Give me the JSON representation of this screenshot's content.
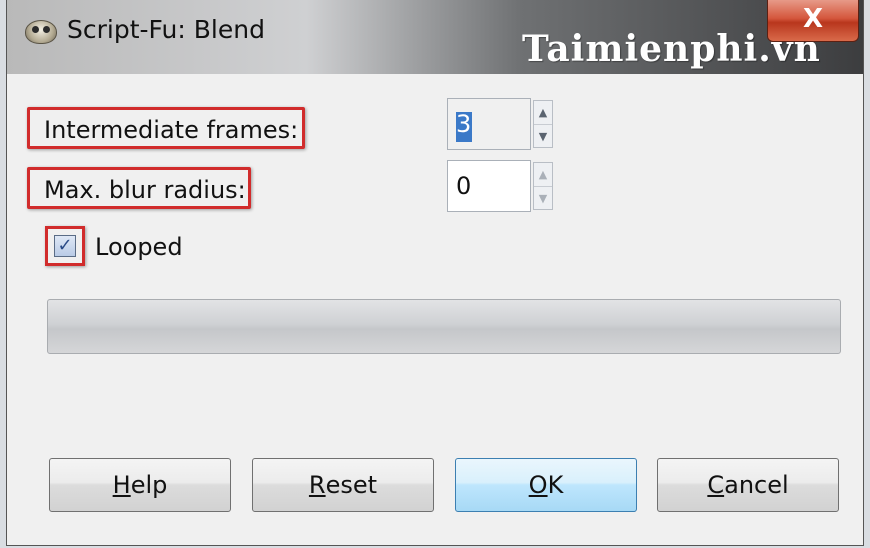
{
  "window": {
    "title": "Script-Fu: Blend",
    "watermark": "Taimienphi.vn",
    "close_glyph": "X",
    "icon": "gimp-wilber-icon"
  },
  "fields": {
    "intermediate_frames": {
      "label": "Intermediate frames:",
      "value": "3"
    },
    "max_blur_radius": {
      "label": "Max. blur radius:",
      "value": "0"
    }
  },
  "looped": {
    "label": "Looped",
    "checked": true
  },
  "progress": {
    "value": 0
  },
  "buttons": {
    "help": {
      "mnemonic": "H",
      "rest": "elp"
    },
    "reset": {
      "mnemonic": "R",
      "rest": "eset"
    },
    "ok": {
      "mnemonic": "O",
      "rest": "K"
    },
    "cancel": {
      "mnemonic": "C",
      "rest": "ancel"
    }
  },
  "colors": {
    "highlight_border": "#d12c2c",
    "selection": "#3b79c8",
    "default_button": "#bee6fd"
  }
}
